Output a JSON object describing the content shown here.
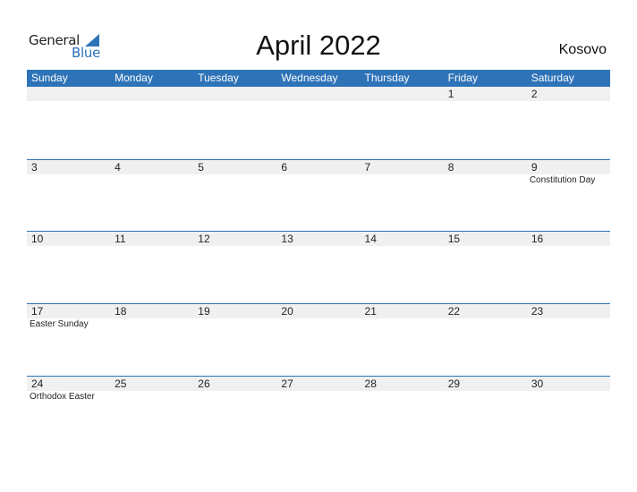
{
  "logo": {
    "word1": "General",
    "word2": "Blue"
  },
  "title": "April 2022",
  "country": "Kosovo",
  "colors": {
    "accent": "#2e73b8",
    "strip": "#f0f0f0"
  },
  "weekdays": [
    "Sunday",
    "Monday",
    "Tuesday",
    "Wednesday",
    "Thursday",
    "Friday",
    "Saturday"
  ],
  "weeks": [
    {
      "days": [
        {
          "num": "",
          "holiday": ""
        },
        {
          "num": "",
          "holiday": ""
        },
        {
          "num": "",
          "holiday": ""
        },
        {
          "num": "",
          "holiday": ""
        },
        {
          "num": "",
          "holiday": ""
        },
        {
          "num": "1",
          "holiday": ""
        },
        {
          "num": "2",
          "holiday": ""
        }
      ]
    },
    {
      "days": [
        {
          "num": "3",
          "holiday": ""
        },
        {
          "num": "4",
          "holiday": ""
        },
        {
          "num": "5",
          "holiday": ""
        },
        {
          "num": "6",
          "holiday": ""
        },
        {
          "num": "7",
          "holiday": ""
        },
        {
          "num": "8",
          "holiday": ""
        },
        {
          "num": "9",
          "holiday": "Constitution Day"
        }
      ]
    },
    {
      "days": [
        {
          "num": "10",
          "holiday": ""
        },
        {
          "num": "11",
          "holiday": ""
        },
        {
          "num": "12",
          "holiday": ""
        },
        {
          "num": "13",
          "holiday": ""
        },
        {
          "num": "14",
          "holiday": ""
        },
        {
          "num": "15",
          "holiday": ""
        },
        {
          "num": "16",
          "holiday": ""
        }
      ]
    },
    {
      "days": [
        {
          "num": "17",
          "holiday": "Easter Sunday"
        },
        {
          "num": "18",
          "holiday": ""
        },
        {
          "num": "19",
          "holiday": ""
        },
        {
          "num": "20",
          "holiday": ""
        },
        {
          "num": "21",
          "holiday": ""
        },
        {
          "num": "22",
          "holiday": ""
        },
        {
          "num": "23",
          "holiday": ""
        }
      ]
    },
    {
      "days": [
        {
          "num": "24",
          "holiday": "Orthodox Easter"
        },
        {
          "num": "25",
          "holiday": ""
        },
        {
          "num": "26",
          "holiday": ""
        },
        {
          "num": "27",
          "holiday": ""
        },
        {
          "num": "28",
          "holiday": ""
        },
        {
          "num": "29",
          "holiday": ""
        },
        {
          "num": "30",
          "holiday": ""
        }
      ]
    }
  ]
}
